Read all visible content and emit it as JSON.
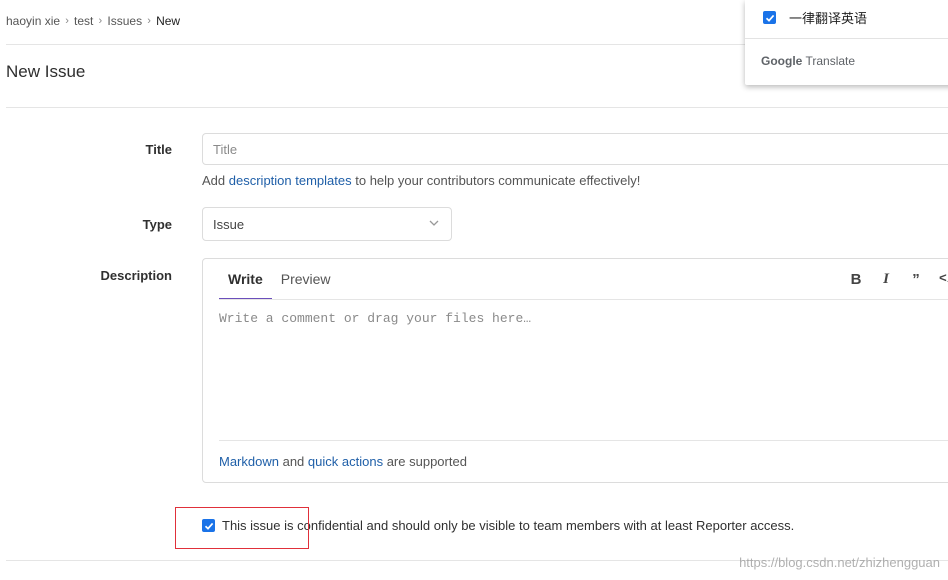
{
  "breadcrumb": [
    "haoyin xie",
    "test",
    "Issues",
    "New"
  ],
  "page_title": "New Issue",
  "form": {
    "title_label": "Title",
    "title_placeholder": "Title",
    "help_prefix": "Add",
    "help_link": "description templates",
    "help_suffix": "to help your contributors communicate effectively!",
    "type_label": "Type",
    "type_value": "Issue",
    "description_label": "Description",
    "tabs": {
      "write": "Write",
      "preview": "Preview"
    },
    "toolbar": {
      "bold": "B",
      "italic": "I",
      "quote": "99",
      "code": "</"
    },
    "description_placeholder": "Write a comment or drag your files here…",
    "footer_link1": "Markdown",
    "footer_and": "and",
    "footer_link2": "quick actions",
    "footer_suffix": "are supported",
    "confidential_text": "This issue is confidential and should only be visible to team members with at least Reporter access.",
    "confidential_checked": true
  },
  "translate_popup": {
    "option_label": "一律翻译英语",
    "option_checked": true,
    "brand_google": "Google",
    "brand_translate": "Translate"
  },
  "watermark": "https://blog.csdn.net/zhizhengguan",
  "colors": {
    "link": "#1f5fa8",
    "active_tab": "#6b4fbb",
    "checkbox": "#1a73e8",
    "highlight": "#e0303a"
  }
}
